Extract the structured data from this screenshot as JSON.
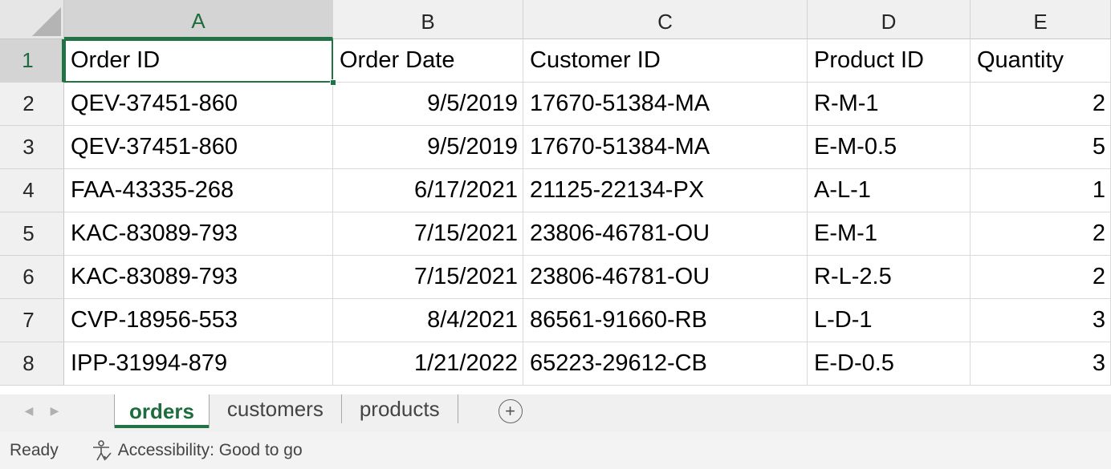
{
  "grid": {
    "columns": [
      "A",
      "B",
      "C",
      "D",
      "E"
    ],
    "active_column": "A",
    "active_row": "1",
    "rows": [
      {
        "num": "1",
        "cells": [
          "Order ID",
          "Order Date",
          "Customer ID",
          "Product ID",
          "Quantity"
        ]
      },
      {
        "num": "2",
        "cells": [
          "QEV-37451-860",
          "9/5/2019",
          "17670-51384-MA",
          "R-M-1",
          "2"
        ]
      },
      {
        "num": "3",
        "cells": [
          "QEV-37451-860",
          "9/5/2019",
          "17670-51384-MA",
          "E-M-0.5",
          "5"
        ]
      },
      {
        "num": "4",
        "cells": [
          "FAA-43335-268",
          "6/17/2021",
          "21125-22134-PX",
          "A-L-1",
          "1"
        ]
      },
      {
        "num": "5",
        "cells": [
          "KAC-83089-793",
          "7/15/2021",
          "23806-46781-OU",
          "E-M-1",
          "2"
        ]
      },
      {
        "num": "6",
        "cells": [
          "KAC-83089-793",
          "7/15/2021",
          "23806-46781-OU",
          "R-L-2.5",
          "2"
        ]
      },
      {
        "num": "7",
        "cells": [
          "CVP-18956-553",
          "8/4/2021",
          "86561-91660-RB",
          "L-D-1",
          "3"
        ]
      },
      {
        "num": "8",
        "cells": [
          "IPP-31994-879",
          "1/21/2022",
          "65223-29612-CB",
          "E-D-0.5",
          "3"
        ]
      }
    ]
  },
  "sheet_tabs": {
    "tabs": [
      "orders",
      "customers",
      "products"
    ],
    "active": "orders",
    "add_icon": "plus-circle-icon",
    "prev_icon": "chevron-left-icon",
    "next_icon": "chevron-right-icon"
  },
  "status_bar": {
    "ready": "Ready",
    "accessibility": "Accessibility: Good to go",
    "accessibility_icon": "accessibility-person-icon"
  },
  "colors": {
    "accent": "#217346",
    "header_bg": "#f0f0f0",
    "active_header_bg": "#d4d4d4",
    "gridline": "#d9d9d9"
  }
}
